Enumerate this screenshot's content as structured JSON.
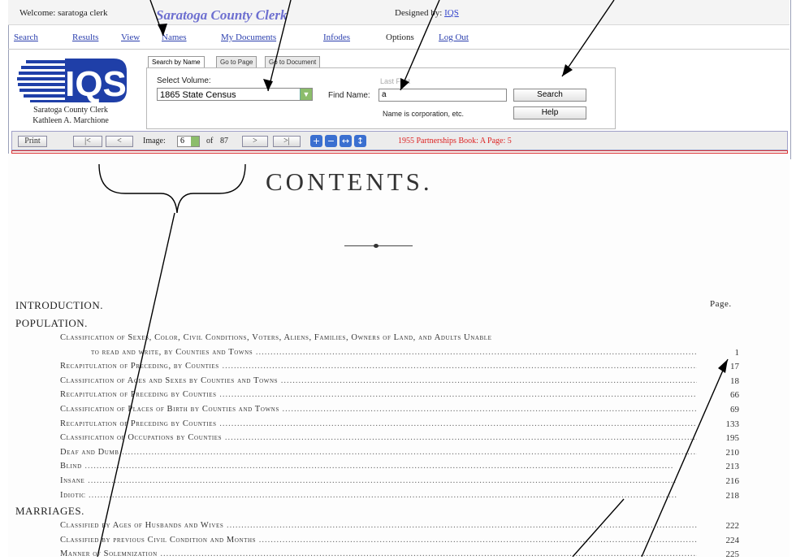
{
  "header": {
    "welcome": "Welcome: saratoga clerk",
    "title": "Saratoga County Clerk",
    "designed_by_prefix": "Designed by:",
    "designed_by_link": "IQS"
  },
  "nav": {
    "search": "Search",
    "results": "Results",
    "view": "View",
    "names": "Names",
    "my_documents": "My Documents",
    "infodes": "Infodes",
    "options": "Options",
    "logout": "Log Out"
  },
  "logo": {
    "text": "IQS",
    "caption_line1": "Saratoga County Clerk",
    "caption_line2": "Kathleen A. Marchione"
  },
  "search": {
    "tabs": [
      "Search by Name",
      "Go to Page",
      "Go to Document"
    ],
    "select_volume_label": "Select Volume:",
    "volume_value": "1865 State Census",
    "find_name_label": "Find Name:",
    "last_first_hint": "Last First",
    "find_name_value": "a",
    "corporation_note": "Name is corporation, etc.",
    "search_button": "Search",
    "help_button": "Help"
  },
  "viewer": {
    "print": "Print",
    "first": "|<",
    "prev": "<",
    "image_label": "Image:",
    "image_value": "6",
    "of_label": "of",
    "total": "87",
    "next": ">",
    "last": ">|",
    "book_label": "1955 Partnerships Book: A Page: 5"
  },
  "document": {
    "title": "CONTENTS.",
    "page_header": "Page.",
    "introduction": "INTRODUCTION.",
    "population": "POPULATION.",
    "marriages": "MARRIAGES.",
    "population_entries": [
      {
        "text": "Classification of Sexes, Color, Civil Conditions, Voters, Aliens, Families, Owners of Land, and Adults Unable",
        "page": ""
      },
      {
        "text": "to read and write, by Counties and Towns",
        "page": "1"
      },
      {
        "text": "Recapitulation of Preceding, by Counties",
        "page": "17"
      },
      {
        "text": "Classification of Ages and Sexes by Counties and Towns",
        "page": "18"
      },
      {
        "text": "Recapitulation of Preceding by Counties",
        "page": "66"
      },
      {
        "text": "Classification of Places of Birth by Counties and Towns",
        "page": "69"
      },
      {
        "text": "Recapitulation of Preceding by Counties",
        "page": "133"
      },
      {
        "text": "Classification of Occupations by Counties",
        "page": "195"
      },
      {
        "text": "Deaf and Dumb",
        "page": "210"
      },
      {
        "text": "Blind",
        "page": "213"
      },
      {
        "text": "Insane",
        "page": "216"
      },
      {
        "text": "Idiotic",
        "page": "218"
      }
    ],
    "marriage_entries": [
      {
        "text": "Classified by Ages of Husbands and Wives",
        "page": "222"
      },
      {
        "text": "Classified by previous Civil Condition and Months",
        "page": "224"
      },
      {
        "text": "Manner of Solemnization",
        "page": "225"
      }
    ]
  },
  "colors": {
    "title_accent": "#6d6fd0",
    "link": "#2b3fae",
    "logo_blue": "#1f3fa8",
    "book_label": "#dd2222",
    "dropdown_green": "#8cbd6b"
  }
}
